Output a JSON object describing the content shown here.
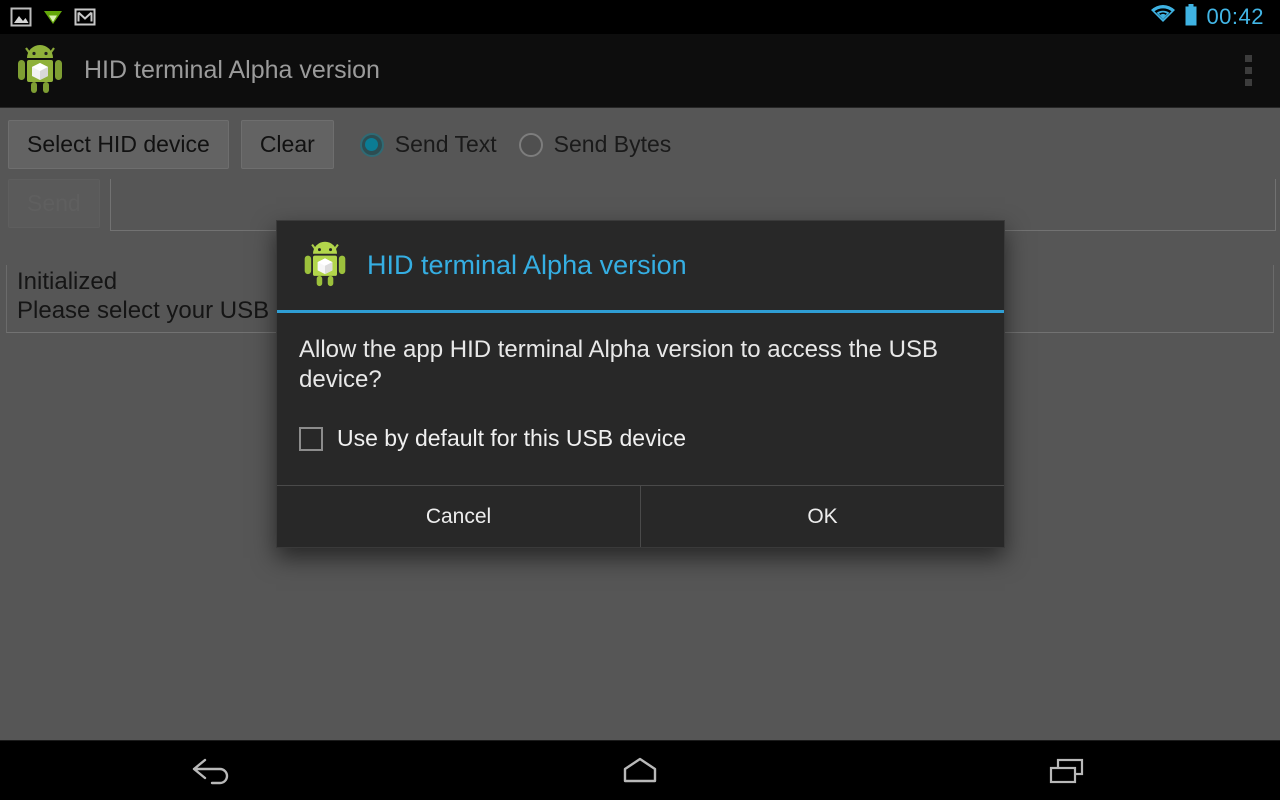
{
  "status_bar": {
    "clock": "00:42",
    "left_icons": [
      {
        "name": "gallery-image-icon"
      },
      {
        "name": "download-arrow-icon"
      },
      {
        "name": "gmail-icon"
      }
    ],
    "right_icons": [
      {
        "name": "wifi-icon"
      },
      {
        "name": "battery-icon"
      }
    ],
    "accent_color": "#42b6e6"
  },
  "app_bar": {
    "icon_name": "android-app-icon",
    "title": "HID terminal Alpha version",
    "overflow_menu_name": "overflow-menu-icon"
  },
  "toolbar": {
    "select_device_label": "Select HID device",
    "clear_label": "Clear",
    "radios": [
      {
        "label": "Send Text",
        "checked": true
      },
      {
        "label": "Send Bytes",
        "checked": false
      }
    ],
    "radio_accent_color": "#0b7c94"
  },
  "send_row": {
    "send_label": "Send",
    "send_enabled": false,
    "input_value": "",
    "input_placeholder": ""
  },
  "log": {
    "lines": [
      "Initialized",
      "Please select your USB device"
    ]
  },
  "dialog": {
    "icon_name": "android-app-icon",
    "title": "HID terminal Alpha version",
    "title_color": "#35aee2",
    "divider_color": "#2f9ed4",
    "message": "Allow the app HID terminal Alpha version to access the USB device?",
    "checkbox": {
      "label": "Use by default for this USB device",
      "checked": false
    },
    "buttons": [
      {
        "label": "Cancel"
      },
      {
        "label": "OK"
      }
    ]
  },
  "nav_bar": {
    "buttons": [
      {
        "name": "nav-back-button"
      },
      {
        "name": "nav-home-button"
      },
      {
        "name": "nav-recents-button"
      }
    ]
  }
}
